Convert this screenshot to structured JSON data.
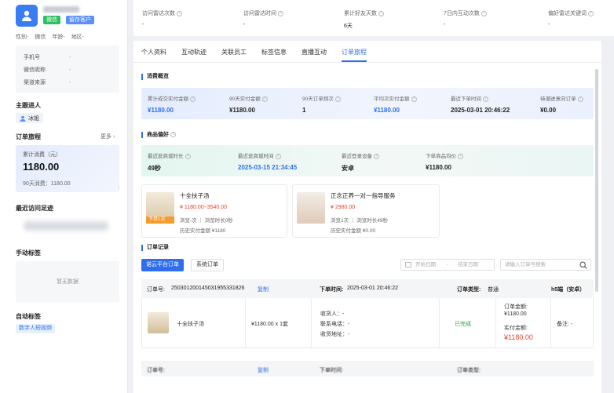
{
  "profile": {
    "tag_wechat": "微信",
    "tag_keep": "留存客户",
    "attrs": [
      "性别-",
      "微信",
      "年龄-",
      "地区-"
    ],
    "info": [
      {
        "k": "手机号",
        "v": "-"
      },
      {
        "k": "微信昵称",
        "v": "-"
      },
      {
        "k": "渠道来源",
        "v": "-"
      }
    ]
  },
  "sidebar": {
    "owner_title": "主跟进人",
    "owner_name": "冰姐",
    "journey_title": "订单旅程",
    "more_label": "更多",
    "spend_label": "累计消费（元）",
    "spend_value": "1180.00",
    "spend_90": "90天消费：1180.00",
    "recent_title": "最近访问足迹",
    "manual_title": "手动标签",
    "manual_empty": "暂无数据",
    "auto_title": "自动标签",
    "auto_tag": "数字人短视频",
    "yen": "¥"
  },
  "stats": [
    {
      "label": "访问雷达次数",
      "value": "-"
    },
    {
      "label": "访问雷达时间",
      "value": "-"
    },
    {
      "label": "累计好友天数",
      "value": "6天"
    },
    {
      "label": "7日内互动次数",
      "value": "-"
    },
    {
      "label": "偏好雷达关键词",
      "value": "-"
    }
  ],
  "tabs": [
    "个人资料",
    "互动轨迹",
    "关联员工",
    "标签信息",
    "直播互动",
    "订单旅程"
  ],
  "consume": {
    "title": "消费概览",
    "items": [
      {
        "label": "累计成交实付金额",
        "value": "¥1180.00",
        "blue": true
      },
      {
        "label": "90天实付金额",
        "value": "¥1180.00",
        "blue": false
      },
      {
        "label": "90天订单频次",
        "value": "1",
        "blue": false
      },
      {
        "label": "平均次实付金额",
        "value": "¥1180.00",
        "blue": true
      },
      {
        "label": "最近下单时间",
        "value": "2025-03-01 20:46:22",
        "blue": false
      },
      {
        "label": "待潮进意向订单",
        "value": "¥0.00",
        "blue": false
      }
    ]
  },
  "preference": {
    "title": "商品偏好",
    "items": [
      {
        "label": "最近逛商城时长",
        "value": "49秒",
        "blue": false
      },
      {
        "label": "最近逛商城时间",
        "value": "2025-03-15 21:34:45",
        "blue": true
      },
      {
        "label": "最近登录设备",
        "value": "安卓",
        "blue": false
      },
      {
        "label": "下单商品均价",
        "value": "¥1180.00",
        "blue": false
      }
    ]
  },
  "products": [
    {
      "title": "十全扶子汤",
      "price": "¥ 1180.00~3540.00",
      "meta": "浏览-次 ｜ 浏览时长0秒",
      "history": "历史实付金额 ¥1180",
      "badge": "下单1次"
    },
    {
      "title": "正念正养一对一指导服务",
      "price": "¥ 2980.00",
      "meta": "浏览1次 ｜ 浏览时长49秒",
      "history": "历史实付金额 ¥0.00",
      "badge": ""
    }
  ],
  "orders": {
    "title": "订单记录",
    "btn_platform": "诺云平台订单",
    "btn_system": "系统订单",
    "date_start": "开始日期",
    "date_sep": "-",
    "date_end": "结束日期",
    "search_placeholder": "请输入订单号搜索",
    "row": {
      "no_label": "订单号:",
      "no_value": "250301200145031955331826",
      "copy": "复制",
      "time_label": "下单时间:",
      "time_value": "2025-03-01 20:46:22",
      "type_label": "订单类型:",
      "type_value": "普通",
      "device": "h5端（安卓）",
      "product": "十全扶子汤",
      "qty": "¥1180.00 x 1套",
      "receiver": "收货人：-",
      "phone": "联系电话：-",
      "address": "收货地址：-",
      "status": "已完成",
      "order_amount_label": "订单金额:",
      "order_amount": "¥1180.00",
      "paid_label": "实付金额:",
      "paid": "¥1180.00",
      "remark": "备注: -"
    },
    "row2": {
      "no_label": "订单号:",
      "copy": "复制",
      "time_label": "下单时间:",
      "type_label": "订单类型:"
    }
  }
}
